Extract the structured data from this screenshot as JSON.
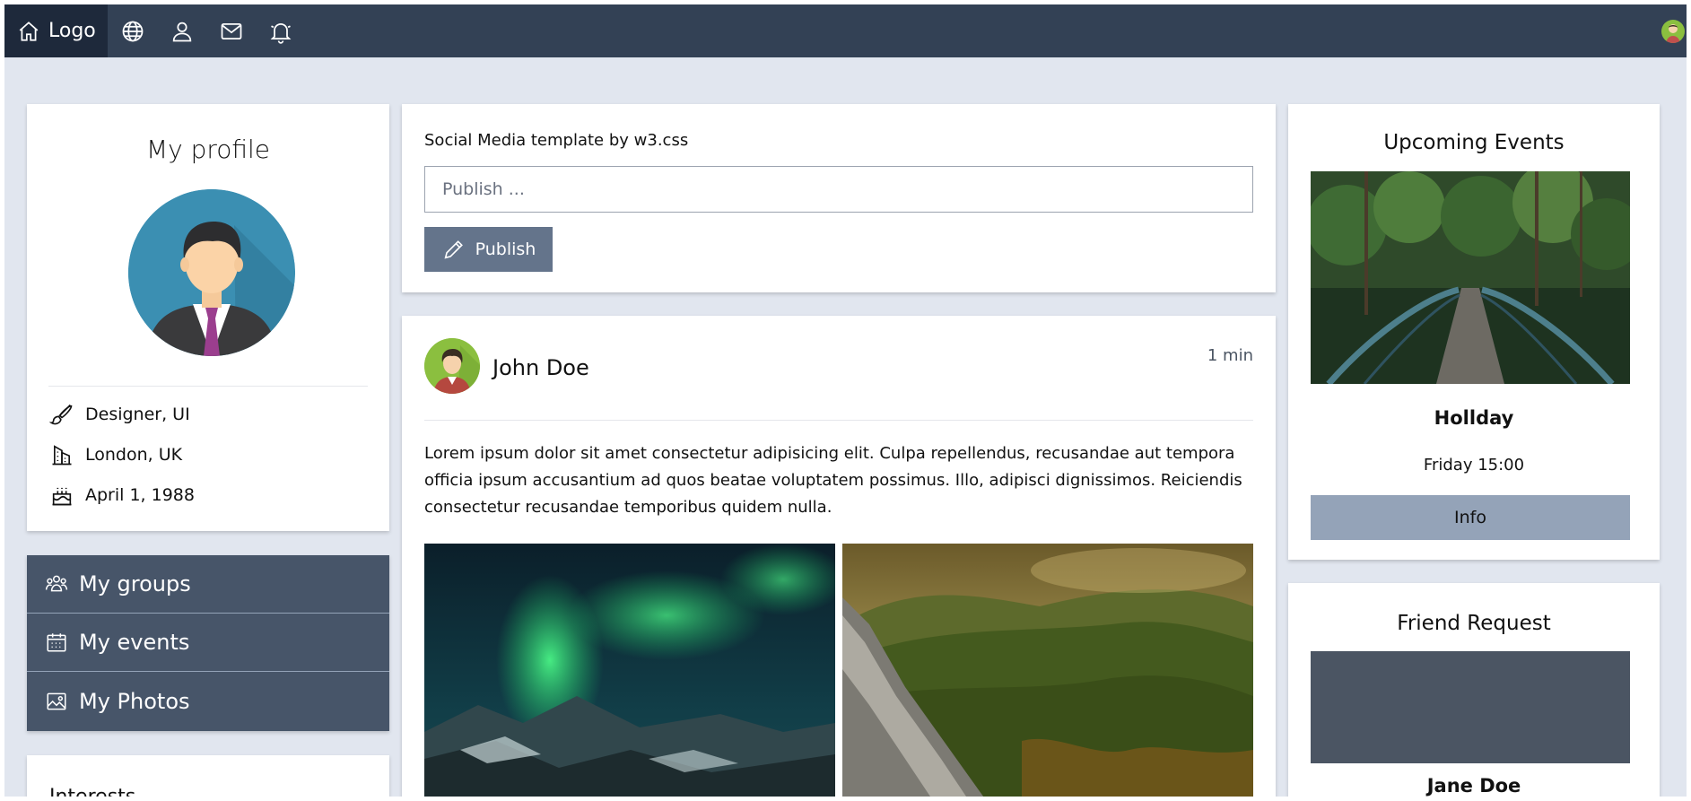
{
  "topbar": {
    "logo_label": "Logo",
    "icons": [
      "home-icon",
      "globe-icon",
      "user-icon",
      "mail-icon",
      "bell-icon"
    ],
    "bg": "#334155",
    "active_bg": "#1e293b"
  },
  "profile": {
    "title": "My profile",
    "details": [
      {
        "icon": "paintbrush-icon",
        "text": "Designer, UI"
      },
      {
        "icon": "building-icon",
        "text": "London, UK"
      },
      {
        "icon": "cake-icon",
        "text": "April 1, 1988"
      }
    ]
  },
  "menu": {
    "items": [
      {
        "icon": "groups-icon",
        "label": "My groups"
      },
      {
        "icon": "calendar-icon",
        "label": "My events"
      },
      {
        "icon": "photo-icon",
        "label": "My Photos"
      }
    ],
    "bg": "#475569"
  },
  "interests": {
    "title": "Interests"
  },
  "compose": {
    "title": "Social Media template by w3.css",
    "placeholder": "Publish ...",
    "publish_label": "Publish"
  },
  "post": {
    "author": "John Doe",
    "time": "1 min",
    "text": "Lorem ipsum dolor sit amet consectetur adipisicing elit. Culpa repellendus, recusandae aut tempora officia ipsum accusantium ad quos beatae voluptatem possimus. Illo, adipisci dignissimos. Reiciendis consectetur recusandae temporibus quidem nulla."
  },
  "events": {
    "title": "Upcoming Events",
    "name": "Hollday",
    "time": "Friday 15:00",
    "info_label": "Info"
  },
  "friend_request": {
    "title": "Friend Request",
    "name": "Jane Doe"
  }
}
